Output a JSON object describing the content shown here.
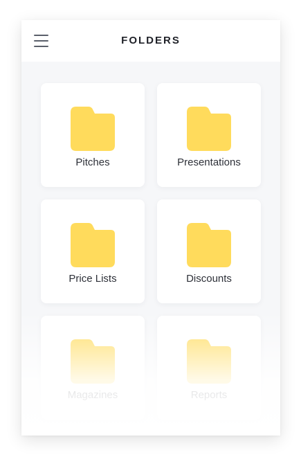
{
  "header": {
    "title": "FOLDERS",
    "menu_icon": "hamburger-menu-icon"
  },
  "folders": [
    {
      "label": "Pitches",
      "icon": "folder-icon"
    },
    {
      "label": "Presentations",
      "icon": "folder-icon"
    },
    {
      "label": "Price Lists",
      "icon": "folder-icon"
    },
    {
      "label": "Discounts",
      "icon": "folder-icon"
    },
    {
      "label": "Magazines",
      "icon": "folder-icon"
    },
    {
      "label": "Reports",
      "icon": "folder-icon"
    }
  ],
  "colors": {
    "folder": "#ffdb5c",
    "background": "#f6f7f9",
    "card": "#ffffff",
    "title": "#1f2128"
  }
}
